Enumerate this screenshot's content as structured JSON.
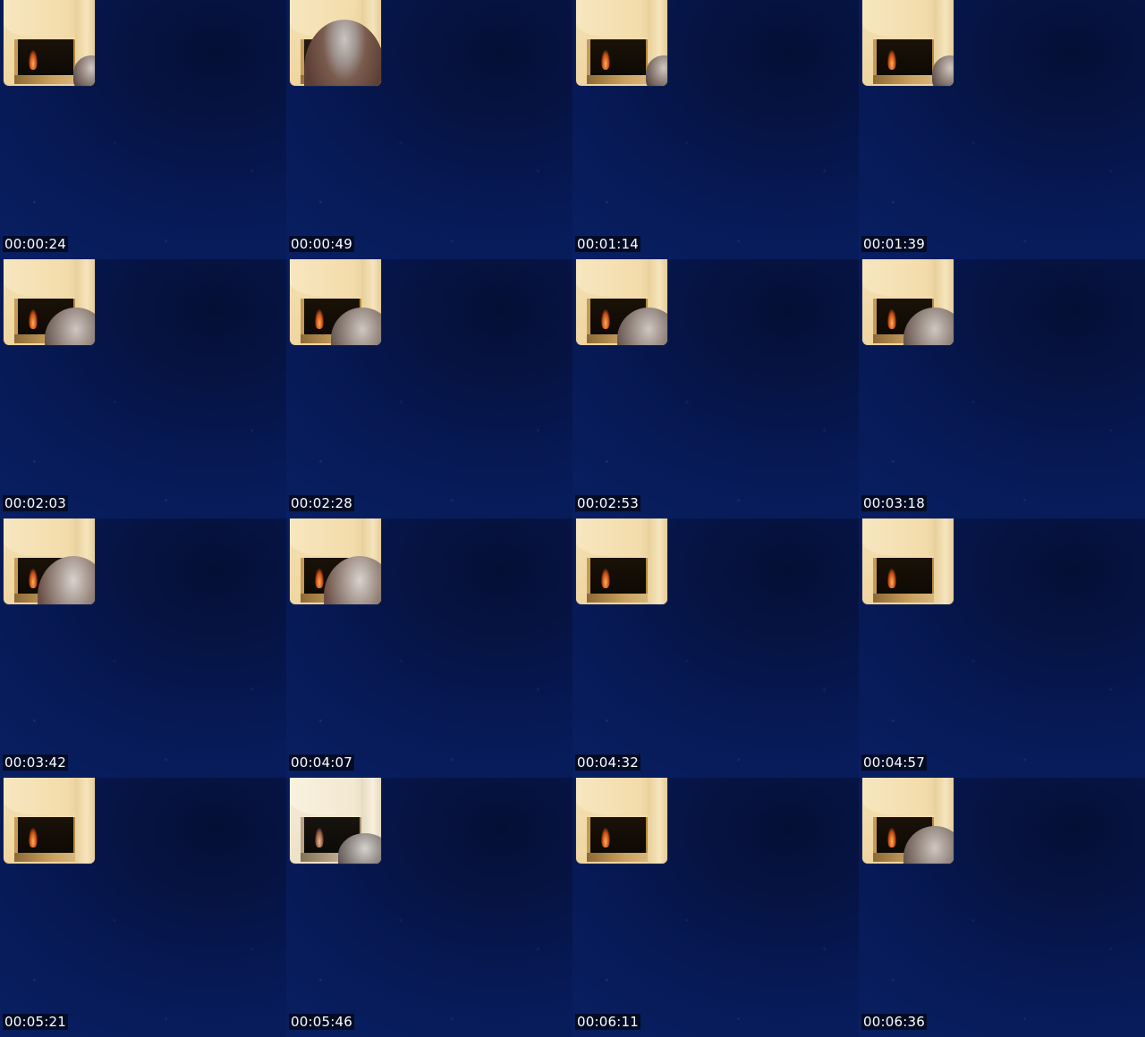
{
  "contact_sheet": {
    "frames": [
      {
        "timestamp": "00:00:24",
        "thumbnail": "fireplace-with-head-top-right"
      },
      {
        "timestamp": "00:00:49",
        "thumbnail": "close-up-face"
      },
      {
        "timestamp": "00:01:14",
        "thumbnail": "fireplace-with-head-top-right"
      },
      {
        "timestamp": "00:01:39",
        "thumbnail": "fireplace-with-head-top-right"
      },
      {
        "timestamp": "00:02:03",
        "thumbnail": "fireplace-with-head-lower-right"
      },
      {
        "timestamp": "00:02:28",
        "thumbnail": "fireplace-with-head-lower-right"
      },
      {
        "timestamp": "00:02:53",
        "thumbnail": "fireplace-with-head-lower-right"
      },
      {
        "timestamp": "00:03:18",
        "thumbnail": "fireplace-with-head-lower-right"
      },
      {
        "timestamp": "00:03:42",
        "thumbnail": "fireplace-with-head-lower-right"
      },
      {
        "timestamp": "00:04:07",
        "thumbnail": "fireplace-with-head-lower-right"
      },
      {
        "timestamp": "00:04:32",
        "thumbnail": "fireplace-empty"
      },
      {
        "timestamp": "00:04:57",
        "thumbnail": "fireplace-empty"
      },
      {
        "timestamp": "00:05:21",
        "thumbnail": "fireplace-empty"
      },
      {
        "timestamp": "00:05:46",
        "thumbnail": "fireplace-faded-with-head"
      },
      {
        "timestamp": "00:06:11",
        "thumbnail": "fireplace-empty"
      },
      {
        "timestamp": "00:06:36",
        "thumbnail": "fireplace-with-head-lower-right"
      }
    ]
  },
  "colors": {
    "background": "#061445",
    "timestamp_text": "#ffffff",
    "timestamp_bg": "#000000"
  }
}
